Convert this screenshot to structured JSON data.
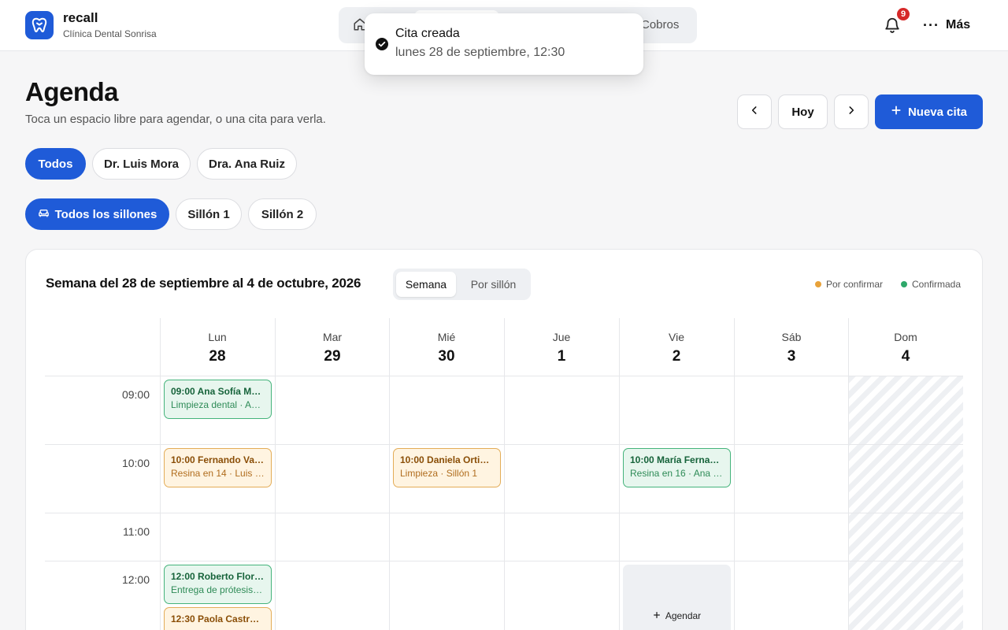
{
  "brand": {
    "name": "recall",
    "clinic": "Clínica Dental Sonrisa"
  },
  "nav": {
    "cobros_label": "Cobros"
  },
  "notifications": {
    "count": "9"
  },
  "more": {
    "label": "Más"
  },
  "toast": {
    "title": "Cita creada",
    "subtitle": "lunes 28 de septiembre, 12:30"
  },
  "header": {
    "title": "Agenda",
    "subtitle": "Toca un espacio libre para agendar, o una cita para verla.",
    "today_label": "Hoy",
    "new_label": "Nueva cita"
  },
  "doctor_filters": [
    "Todos",
    "Dr. Luis Mora",
    "Dra. Ana Ruiz"
  ],
  "chair_filters": [
    "Todos los sillones",
    "Sillón 1",
    "Sillón 2"
  ],
  "calendar": {
    "week_title": "Semana del 28 de septiembre al 4 de octubre, 2026",
    "view_week": "Semana",
    "view_chair": "Por sillón",
    "legend": {
      "pending": "Por confirmar",
      "confirmed": "Confirmada"
    },
    "days": [
      {
        "name": "Lun",
        "num": "28"
      },
      {
        "name": "Mar",
        "num": "29"
      },
      {
        "name": "Mié",
        "num": "30"
      },
      {
        "name": "Jue",
        "num": "1"
      },
      {
        "name": "Vie",
        "num": "2"
      },
      {
        "name": "Sáb",
        "num": "3"
      },
      {
        "name": "Dom",
        "num": "4"
      }
    ],
    "times": [
      "09:00",
      "10:00",
      "11:00",
      "12:00"
    ],
    "appointments": [
      {
        "title": "09:00 Ana Sofía M…",
        "detail": "Limpieza dental · A…",
        "status": "confirmed"
      },
      {
        "title": "10:00 Fernando Va…",
        "detail": "Resina en 14 · Luis …",
        "status": "pending"
      },
      {
        "title": "10:00 Daniela Ortiz…",
        "detail": "Limpieza · Sillón 1",
        "status": "pending"
      },
      {
        "title": "10:00 María Ferna…",
        "detail": "Resina en 16 · Ana R…",
        "status": "confirmed"
      },
      {
        "title": "12:00 Roberto Flor…",
        "detail": "Entrega de prótesis…",
        "status": "confirmed"
      },
      {
        "title": "12:30 Paola Castro…",
        "detail": "",
        "status": "pending"
      }
    ],
    "slot_label": "Agendar"
  },
  "colors": {
    "accent": "#1f5bd8",
    "confirmed": "#2ea86a",
    "pending": "#e8a23a",
    "badge": "#d62828"
  }
}
